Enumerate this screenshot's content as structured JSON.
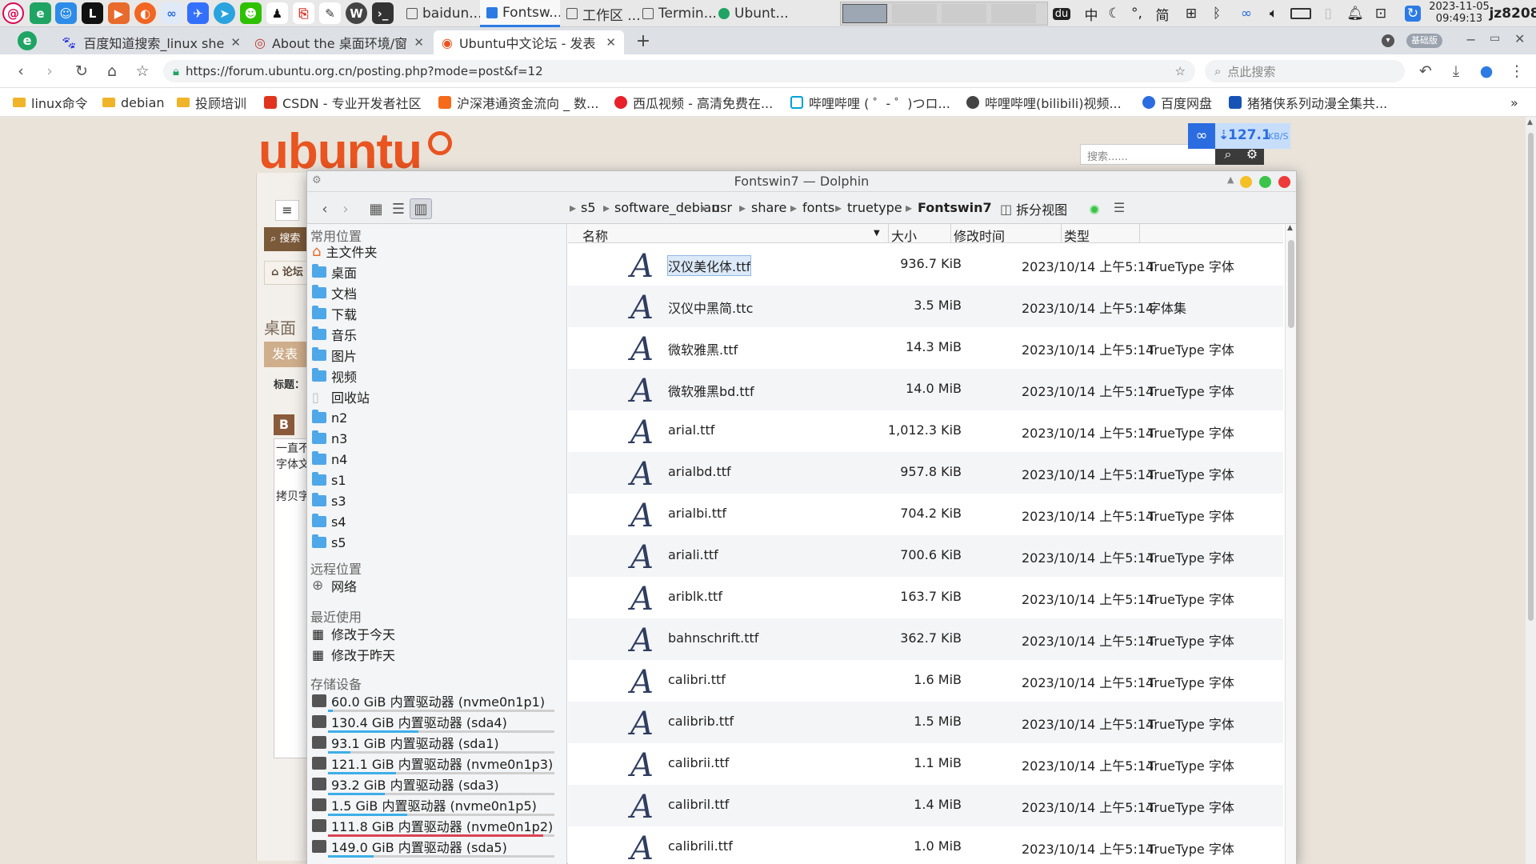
{
  "taskbar": {
    "tasks": [
      {
        "label": "baidun..."
      },
      {
        "label": "Fontsw..."
      },
      {
        "label": "工作区 ..."
      },
      {
        "label": "Termin..."
      },
      {
        "label": "Ubunt..."
      }
    ],
    "tray": {
      "ime": "中",
      "moon": "☾",
      "punct": "°,",
      "simp": "简",
      "date": "2023-11-05",
      "time": "09:49:13",
      "user": "jz8208"
    }
  },
  "browser": {
    "tabs": [
      {
        "label": "百度知道搜索_linux she"
      },
      {
        "label": "About the 桌面环境/窗"
      },
      {
        "label": "Ubuntu中文论坛 - 发表"
      }
    ],
    "url": "https://forum.ubuntu.org.cn/posting.php?mode=post&f=12",
    "search_placeholder": "点此搜索",
    "badge": "基础版",
    "bookmarks": [
      {
        "label": "linux命令"
      },
      {
        "label": "debian"
      },
      {
        "label": "投顾培训"
      },
      {
        "label": "CSDN - 专业开发者社区"
      },
      {
        "label": "沪深港通资金流向 _ 数..."
      },
      {
        "label": "西瓜视频 - 高清免费在..."
      },
      {
        "label": "哔哩哔哩 ( ゜- ゜)つロ..."
      },
      {
        "label": "哔哩哔哩(bilibili)视频..."
      },
      {
        "label": "百度网盘"
      },
      {
        "label": "猪猪侠系列动漫全集共..."
      }
    ]
  },
  "webpage": {
    "logo": "ubuntu",
    "search_placeholder": "搜索......",
    "download_speed": "127.1",
    "speed_unit": "KB/S",
    "side_search": "搜索",
    "forum_link": "论坛",
    "heading": "桌面",
    "post_button": "发表",
    "title_label": "标题：",
    "bold": "B",
    "text1": "一直不",
    "text2": "字体文",
    "text3": "拷贝字"
  },
  "dolphin": {
    "title": "Fontswin7 — Dolphin",
    "breadcrumbs": [
      "s5",
      "software_debian",
      "usr",
      "share",
      "fonts",
      "truetype",
      "Fontswin7"
    ],
    "split_view": "拆分视图",
    "sections": {
      "places": "常用位置",
      "remote": "远程位置",
      "recent": "最近使用",
      "devices": "存储设备"
    },
    "places": [
      "主文件夹",
      "桌面",
      "文档",
      "下载",
      "音乐",
      "图片",
      "视频",
      "回收站",
      "n2",
      "n3",
      "n4",
      "s1",
      "s3",
      "s4",
      "s5"
    ],
    "remote": [
      "网络"
    ],
    "recent": [
      "修改于今天",
      "修改于昨天"
    ],
    "devices": [
      {
        "label": "60.0 GiB 内置驱动器 (nvme0n1p1)",
        "usage": 0.02,
        "color": "#3daee9"
      },
      {
        "label": "130.4 GiB 内置驱动器 (sda4)",
        "usage": 0.4,
        "color": "#3daee9"
      },
      {
        "label": "93.1 GiB 内置驱动器 (sda1)",
        "usage": 0.1,
        "color": "#3daee9"
      },
      {
        "label": "121.1 GiB 内置驱动器 (nvme0n1p3)",
        "usage": 0.3,
        "color": "#3daee9"
      },
      {
        "label": "93.2 GiB 内置驱动器 (sda3)",
        "usage": 0.25,
        "color": "#3daee9"
      },
      {
        "label": "1.5 GiB 内置驱动器 (nvme0n1p5)",
        "usage": 0.35,
        "color": "#3daee9"
      },
      {
        "label": "111.8 GiB 内置驱动器 (nvme0n1p2)",
        "usage": 0.95,
        "color": "#da4453"
      },
      {
        "label": "149.0 GiB 内置驱动器 (sda5)",
        "usage": 0.2,
        "color": "#3daee9"
      }
    ],
    "columns": {
      "name": "名称",
      "size": "大小",
      "modified": "修改时间",
      "type": "类型"
    },
    "files": [
      {
        "name": "汉仪美化体.ttf",
        "size": "936.7 KiB",
        "modified": "2023/10/14 上午5:14",
        "type": "TrueType 字体"
      },
      {
        "name": "汉仪中黑简.ttc",
        "size": "3.5 MiB",
        "modified": "2023/10/14 上午5:14",
        "type": "字体集"
      },
      {
        "name": "微软雅黑.ttf",
        "size": "14.3 MiB",
        "modified": "2023/10/14 上午5:14",
        "type": "TrueType 字体"
      },
      {
        "name": "微软雅黑bd.ttf",
        "size": "14.0 MiB",
        "modified": "2023/10/14 上午5:14",
        "type": "TrueType 字体"
      },
      {
        "name": "arial.ttf",
        "size": "1,012.3 KiB",
        "modified": "2023/10/14 上午5:14",
        "type": "TrueType 字体"
      },
      {
        "name": "arialbd.ttf",
        "size": "957.8 KiB",
        "modified": "2023/10/14 上午5:14",
        "type": "TrueType 字体"
      },
      {
        "name": "arialbi.ttf",
        "size": "704.2 KiB",
        "modified": "2023/10/14 上午5:14",
        "type": "TrueType 字体"
      },
      {
        "name": "ariali.ttf",
        "size": "700.6 KiB",
        "modified": "2023/10/14 上午5:14",
        "type": "TrueType 字体"
      },
      {
        "name": "ariblk.ttf",
        "size": "163.7 KiB",
        "modified": "2023/10/14 上午5:14",
        "type": "TrueType 字体"
      },
      {
        "name": "bahnschrift.ttf",
        "size": "362.7 KiB",
        "modified": "2023/10/14 上午5:14",
        "type": "TrueType 字体"
      },
      {
        "name": "calibri.ttf",
        "size": "1.6 MiB",
        "modified": "2023/10/14 上午5:14",
        "type": "TrueType 字体"
      },
      {
        "name": "calibrib.ttf",
        "size": "1.5 MiB",
        "modified": "2023/10/14 上午5:14",
        "type": "TrueType 字体"
      },
      {
        "name": "calibrii.ttf",
        "size": "1.1 MiB",
        "modified": "2023/10/14 上午5:14",
        "type": "TrueType 字体"
      },
      {
        "name": "calibril.ttf",
        "size": "1.4 MiB",
        "modified": "2023/10/14 上午5:14",
        "type": "TrueType 字体"
      },
      {
        "name": "calibrili.ttf",
        "size": "1.0 MiB",
        "modified": "2023/10/14 上午5:14",
        "type": "TrueType 字体"
      }
    ]
  }
}
